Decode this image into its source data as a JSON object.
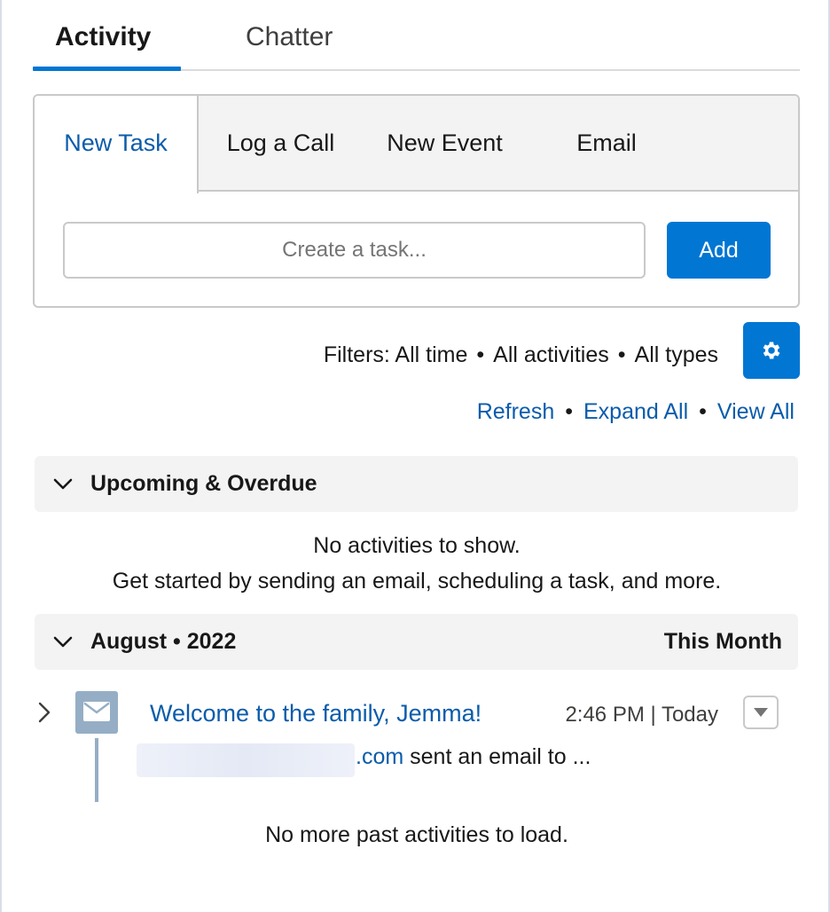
{
  "top_tabs": [
    {
      "label": "Activity",
      "active": true
    },
    {
      "label": "Chatter",
      "active": false
    }
  ],
  "composer": {
    "tabs": [
      "New Task",
      "Log a Call",
      "New Event",
      "Email"
    ],
    "active_tab": "New Task",
    "input_placeholder": "Create a task...",
    "add_label": "Add"
  },
  "filters": {
    "prefix": "Filters:",
    "time": "All time",
    "activities": "All activities",
    "types": "All types",
    "separator": "•",
    "settings_icon": "gear-icon"
  },
  "links": {
    "refresh": "Refresh",
    "expand_all": "Expand All",
    "view_all": "View All"
  },
  "upcoming": {
    "title": "Upcoming & Overdue",
    "empty_line1": "No activities to show.",
    "empty_line2": "Get started by sending an email, scheduling a task, and more."
  },
  "month_section": {
    "title": "August • 2022",
    "right_label": "This Month"
  },
  "activity_item": {
    "icon": "email-icon",
    "title": "Welcome to the family, Jemma!",
    "time": "2:46 PM | Today",
    "sender_domain": ".com",
    "description": "sent an email to ..."
  },
  "footer_message": "No more past activities to load.",
  "colors": {
    "brand": "#0176d3",
    "link": "#0b5cab",
    "section_bg": "#f3f3f3",
    "email_icon_bg": "#95aec5"
  }
}
